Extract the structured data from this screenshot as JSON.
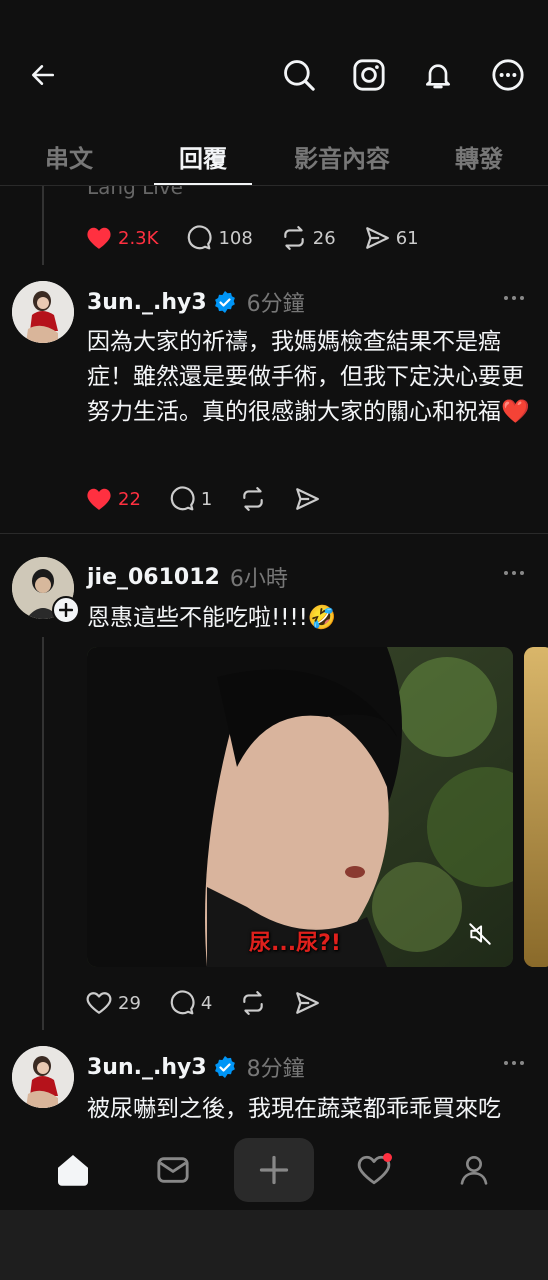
{
  "tabs": [
    "串文",
    "回覆",
    "影音內容",
    "轉發"
  ],
  "active_tab": 1,
  "top_post": {
    "partial_text": "Lang Live",
    "likes": "2.3K",
    "comments": "108",
    "reposts": "26",
    "shares": "61"
  },
  "reply1": {
    "username": "3un._.hy3",
    "time": "6分鐘",
    "text": "因為大家的祈禱，我媽媽檢查結果不是癌症！雖然還是要做手術，但我下定決心要更努力生活。真的很感謝大家的關心和祝福❤️",
    "likes": "22",
    "comments": "1"
  },
  "post2": {
    "username": "jie_061012",
    "time": "6小時",
    "text": "恩惠這些不能吃啦!!!!🤣",
    "media_caption": "尿...尿?!",
    "likes": "29",
    "comments": "4"
  },
  "reply2": {
    "username": "3un._.hy3",
    "time": "8分鐘",
    "text": "被尿嚇到之後，我現在蔬菜都乖乖買來吃"
  },
  "colors": {
    "liked": "#ff3040",
    "verified": "#0095f6",
    "background": "#101010"
  },
  "icons": [
    "back-arrow-icon",
    "search-icon",
    "instagram-icon",
    "bell-icon",
    "more-icon",
    "home-icon",
    "inbox-icon",
    "plus-icon",
    "heart-icon",
    "profile-icon"
  ]
}
